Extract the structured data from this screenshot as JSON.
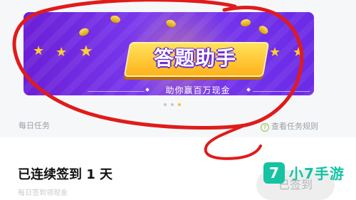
{
  "banner": {
    "title": "答题助手",
    "subtitle": "助你赢百万现金"
  },
  "pager": {
    "count": 3,
    "active_index": 2
  },
  "tasks": {
    "section_title": "每日任务",
    "rules_link": "查看任务规则"
  },
  "checkin": {
    "status_text": "已连续签到 1 天",
    "sub_text": "每日签到领现金",
    "button_label": "已签到"
  },
  "watermark": {
    "glyph": "7",
    "text": "小7手游"
  },
  "colors": {
    "banner_purple": "#6b1fd6",
    "gold": "#ffd12a",
    "annotation_red": "#e01b1b",
    "watermark_teal": "#15c3a3"
  },
  "icons": {
    "stars": "star-icon",
    "rules": "info-circle-icon"
  }
}
